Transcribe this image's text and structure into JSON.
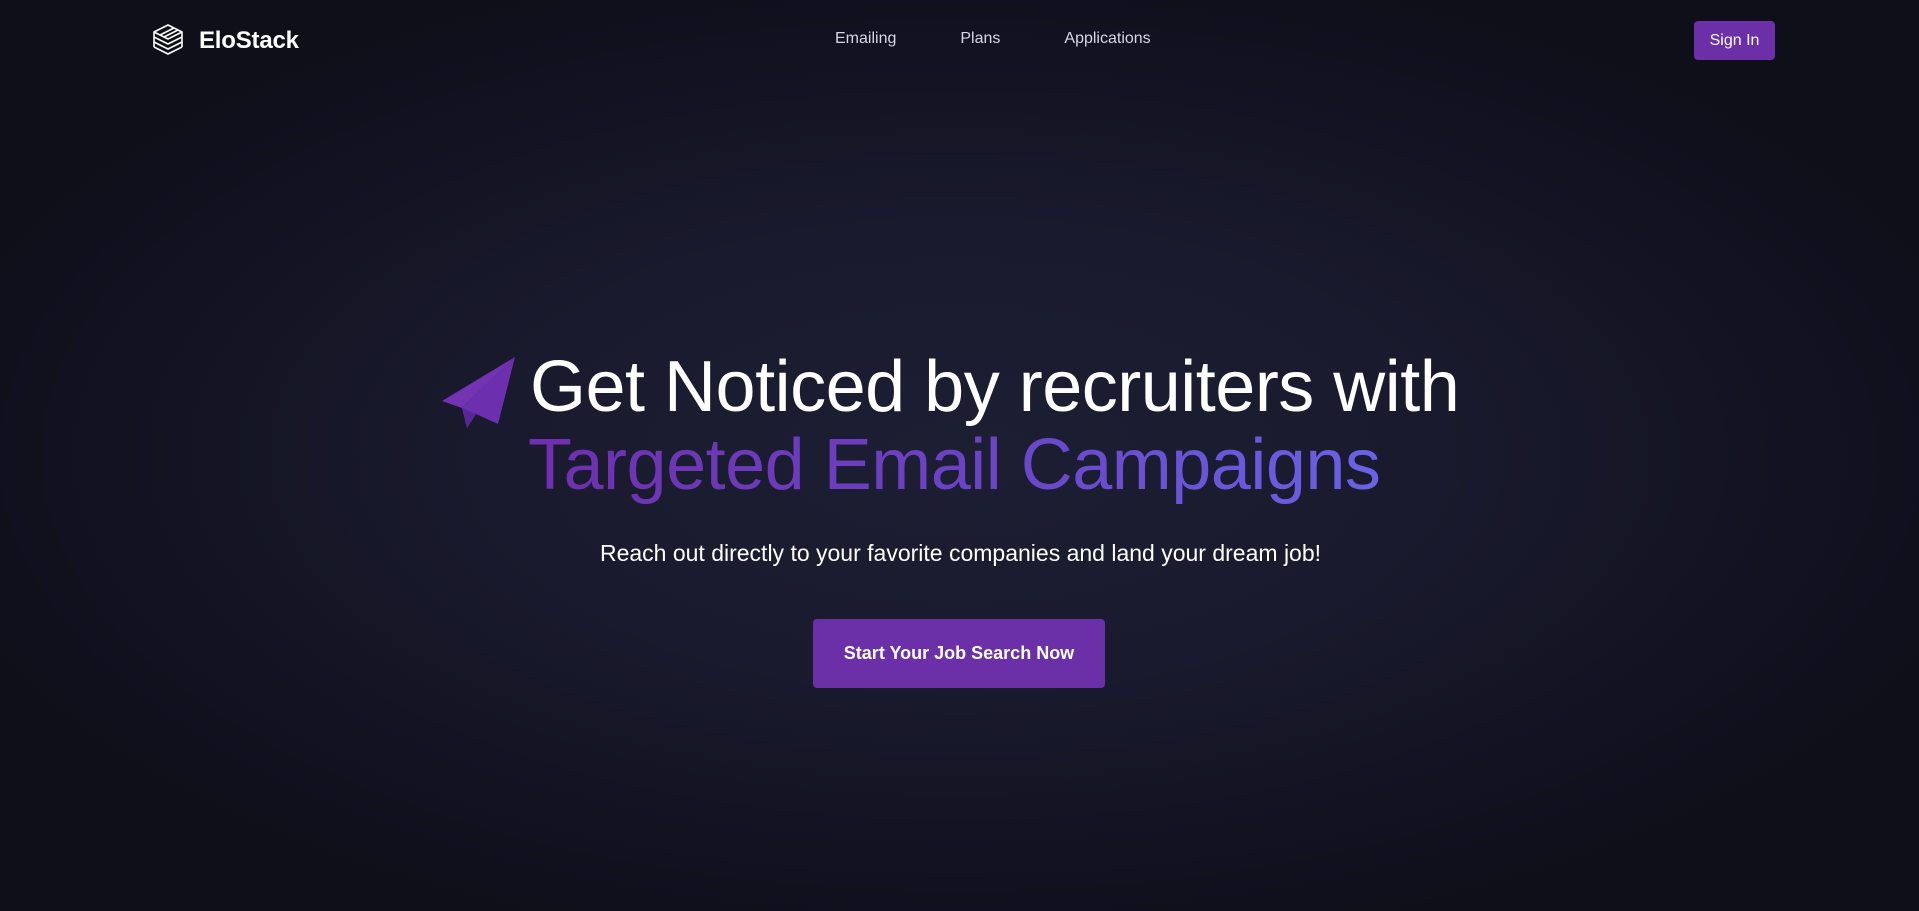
{
  "brand": {
    "name": "EloStack",
    "logo_icon": "layered-stack-icon"
  },
  "nav": {
    "items": [
      {
        "label": "Emailing"
      },
      {
        "label": "Plans"
      },
      {
        "label": "Applications"
      }
    ]
  },
  "header": {
    "signin_label": "Sign In"
  },
  "hero": {
    "icon": "paper-plane-icon",
    "headline_line1": "Get Noticed by recruiters with",
    "headline_line2": "Targeted Email Campaigns",
    "subtext": "Reach out directly to your favorite companies and land your dream job!",
    "cta_label": "Start Your Job Search Now"
  },
  "colors": {
    "background": "#0f0f1a",
    "accent": "#6b2fa8",
    "gradient_start": "#6f2fae",
    "gradient_end": "#6a62e6"
  }
}
